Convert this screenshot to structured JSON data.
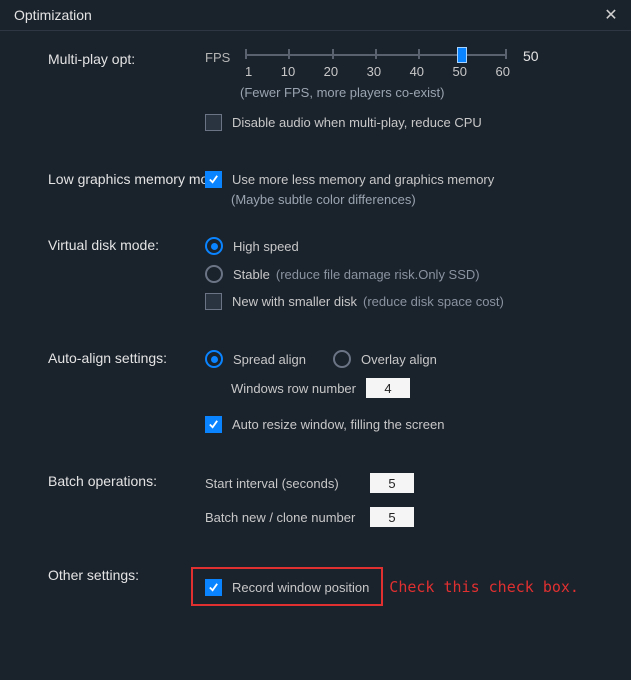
{
  "titlebar": {
    "title": "Optimization",
    "close_glyph": "✕"
  },
  "multiplay": {
    "label": "Multi-play opt:",
    "fps_label": "FPS",
    "current_value": "50",
    "ticks": [
      "1",
      "10",
      "20",
      "30",
      "40",
      "50",
      "60"
    ],
    "hint": "(Fewer FPS, more players co-exist)",
    "disable_audio_label": "Disable audio when multi-play, reduce CPU",
    "disable_audio_checked": false
  },
  "lowgfx": {
    "label": "Low graphics memory mode:",
    "use_less_label": "Use more less memory and graphics memory",
    "use_less_checked": true,
    "hint": "(Maybe subtle color differences)"
  },
  "vdisk": {
    "label": "Virtual disk mode:",
    "high_speed_label": "High speed",
    "high_speed_checked": true,
    "stable_label": "Stable",
    "stable_hint": "(reduce file damage risk.Only SSD)",
    "stable_checked": false,
    "new_smaller_label": "New with smaller disk",
    "new_smaller_hint": "(reduce disk space cost)",
    "new_smaller_checked": false
  },
  "align": {
    "label": "Auto-align settings:",
    "spread_label": "Spread align",
    "spread_checked": true,
    "overlay_label": "Overlay align",
    "overlay_checked": false,
    "windows_row_label": "Windows row number",
    "windows_row_value": "4",
    "auto_resize_label": "Auto resize window, filling the screen",
    "auto_resize_checked": true
  },
  "batch": {
    "label": "Batch operations:",
    "start_interval_label": "Start interval (seconds)",
    "start_interval_value": "5",
    "clone_label": "Batch new / clone number",
    "clone_value": "5"
  },
  "other": {
    "label": "Other settings:",
    "record_pos_label": "Record window position",
    "record_pos_checked": true,
    "annotation": "Check this check box."
  }
}
